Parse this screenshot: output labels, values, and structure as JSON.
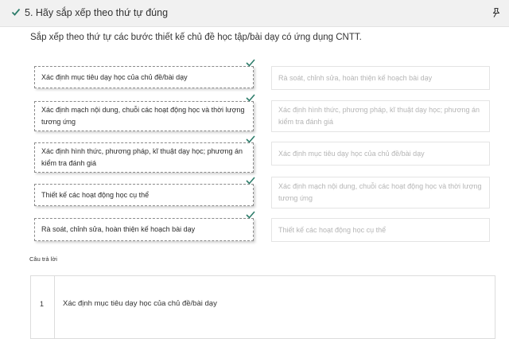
{
  "header": {
    "title": "5. Hãy sắp xếp theo thứ tự đúng",
    "accent": "#2e7d6b"
  },
  "question": {
    "text": "Sắp xếp theo thứ tự các bước thiết kế chủ đề học tập/bài dạy có ứng dụng CNTT."
  },
  "ordered_items": [
    {
      "label": "Xác định mục tiêu dạy học của chủ đề/bài dạy"
    },
    {
      "label": "Xác định mạch nội dung, chuỗi các hoạt động học và thời lượng tương ứng"
    },
    {
      "label": "Xác định hình thức, phương pháp, kĩ thuật dạy học; phương án kiểm tra đánh giá"
    },
    {
      "label": "Thiết kế các hoạt động học cụ thể"
    },
    {
      "label": "Rà soát, chỉnh sửa, hoàn thiện kế hoạch bài dạy"
    }
  ],
  "source_items": [
    {
      "label": "Rà soát, chỉnh sửa, hoàn thiện kế hoạch bài dạy"
    },
    {
      "label": "Xác định hình thức, phương pháp, kĩ thuật dạy học; phương án kiểm tra đánh giá"
    },
    {
      "label": "Xác định mục tiêu dạy học của chủ đề/bài dạy"
    },
    {
      "label": "Xác định mạch nội dung, chuỗi các hoạt động học và thời lượng tương ứng"
    },
    {
      "label": "Thiết kế các hoạt động học cụ thể"
    }
  ],
  "answers": {
    "label": "Câu trả lời",
    "rows": [
      {
        "number": "1",
        "text": "Xác định mục tiêu dạy học của chủ đề/bài dạy"
      }
    ]
  }
}
